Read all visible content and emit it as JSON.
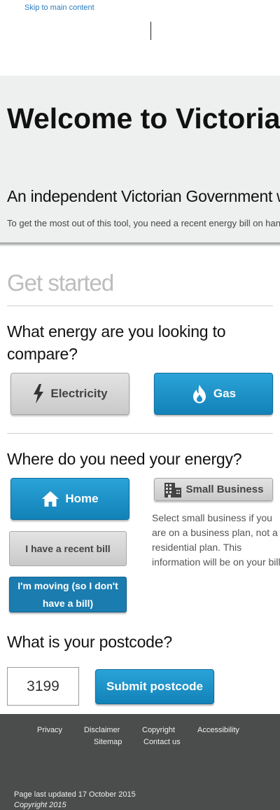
{
  "skip_link": "Skip to main content",
  "hero": {
    "title": "Welcome to Victorian Energy Compare",
    "subtitle": "An independent Victorian Government website",
    "intro": "To get the most out of this tool, you need a recent energy bill on hand."
  },
  "get_started": "Get started",
  "energy_question": "What energy are you looking to compare?",
  "energy_options": {
    "electricity": "Electricity",
    "gas": "Gas"
  },
  "where_question": "Where do you need your energy?",
  "where_options": {
    "home": "Home",
    "small_business": "Small Business"
  },
  "small_business_note": "Select small business if you are on a business plan, not a residential plan. This information will be on your bill.",
  "bill_options": {
    "recent_bill": "I have a recent bill",
    "moving": "I'm moving (so I don't have a bill)"
  },
  "postcode_question": "What is your postcode?",
  "postcode": {
    "value": "3199",
    "submit_label": "Submit postcode"
  },
  "footer": {
    "links": {
      "privacy": "Privacy",
      "disclaimer": "Disclaimer",
      "copyright": "Copyright",
      "accessibility": "Accessibility",
      "sitemap": "Sitemap",
      "contact": "Contact us"
    },
    "last_updated": "Page last updated 17 October 2015",
    "copyright_notice": "Copyright 2015"
  },
  "colors": {
    "primary_blue": "#1a8fc8",
    "hero_bg": "#eef0ef",
    "footer_bg": "#4b4c4c"
  },
  "icons": [
    "lightning-icon",
    "flame-icon",
    "house-icon",
    "building-icon"
  ]
}
